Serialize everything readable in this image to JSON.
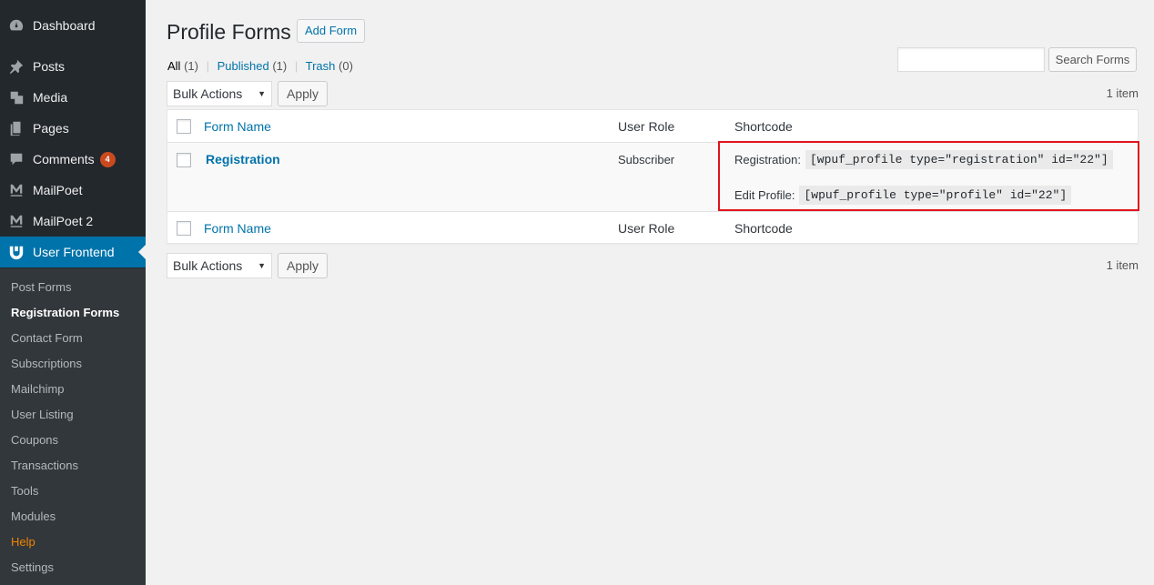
{
  "sidebar": {
    "items": [
      {
        "label": "Dashboard",
        "icon": "dashboard-icon"
      },
      {
        "label": "Posts",
        "icon": "pin-icon"
      },
      {
        "label": "Media",
        "icon": "media-icon"
      },
      {
        "label": "Pages",
        "icon": "pages-icon"
      },
      {
        "label": "Comments",
        "icon": "comment-icon",
        "badge": "4"
      },
      {
        "label": "MailPoet",
        "icon": "mailpoet-icon"
      },
      {
        "label": "MailPoet 2",
        "icon": "mailpoet-icon"
      },
      {
        "label": "User Frontend",
        "icon": "user-frontend-icon"
      }
    ],
    "submenu": [
      "Post Forms",
      "Registration Forms",
      "Contact Form",
      "Subscriptions",
      "Mailchimp",
      "User Listing",
      "Coupons",
      "Transactions",
      "Tools",
      "Modules",
      "Help",
      "Settings"
    ]
  },
  "page": {
    "title": "Profile Forms",
    "add_button": "Add Form"
  },
  "filters": {
    "all": "All",
    "all_count": "(1)",
    "published": "Published",
    "published_count": "(1)",
    "trash": "Trash",
    "trash_count": "(0)",
    "sep": "|"
  },
  "search": {
    "value": "",
    "button": "Search Forms"
  },
  "bulk": {
    "select_value": "Bulk Actions",
    "apply": "Apply",
    "items": "1 item"
  },
  "table": {
    "columns": [
      "Form Name",
      "User Role",
      "Shortcode"
    ],
    "rows": [
      {
        "name": "Registration",
        "role": "Subscriber",
        "registration_label": "Registration:",
        "registration_code": "[wpuf_profile type=\"registration\" id=\"22\"]",
        "edit_label": "Edit Profile:",
        "edit_code": "[wpuf_profile type=\"profile\" id=\"22\"]"
      }
    ]
  },
  "colors": {
    "sidebar_bg": "#23282d",
    "submenu_bg": "#32373c",
    "accent": "#0073aa",
    "badge": "#ca4a1f",
    "help": "#f18500",
    "highlight": "#e0141e"
  }
}
